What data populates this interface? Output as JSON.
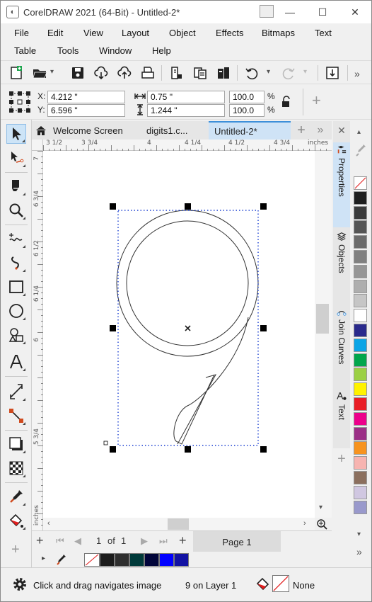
{
  "window": {
    "title": "CorelDRAW 2021 (64-Bit) - Untitled-2*",
    "minimize": "—",
    "maximize": "☐",
    "close": "✕"
  },
  "menu": {
    "row1": [
      "File",
      "Edit",
      "View",
      "Layout",
      "Object",
      "Effects",
      "Bitmaps",
      "Text"
    ],
    "row2": [
      "Table",
      "Tools",
      "Window",
      "Help"
    ]
  },
  "propbar": {
    "x_label": "X:",
    "y_label": "Y:",
    "x_value": "4.212 \"",
    "y_value": "6.596 \"",
    "width_value": "0.75 \"",
    "height_value": "1.244 \"",
    "scale_x": "100.0",
    "scale_y": "100.0",
    "percent_x": "%",
    "percent_y": "%",
    "add": "+"
  },
  "tabs": {
    "welcome": "Welcome Screen",
    "digits": "digits1.c...",
    "current": "Untitled-2*"
  },
  "ruler": {
    "h_labels": [
      "3 1/2",
      "3 3/4",
      "4",
      "4 1/4",
      "4 1/2",
      "4 3/4"
    ],
    "units": "inches",
    "v_labels": [
      "7",
      "6 3/4",
      "6 1/2",
      "6 1/4",
      "6",
      "5 3/4"
    ],
    "v_units": "inches"
  },
  "pagenav": {
    "current": "1",
    "of": "of",
    "total": "1",
    "page_tab": "Page 1",
    "add": "+"
  },
  "docker": {
    "tabs": [
      "Properties",
      "Objects",
      "Join Curves",
      "Text"
    ],
    "close": "✕",
    "add": "+"
  },
  "palette": {
    "colors": [
      "#ffffff",
      "#1e1e1e",
      "#3b3b3b",
      "#545454",
      "#6b6b6b",
      "#808080",
      "#969696",
      "#aeaeae",
      "#c6c6c6",
      "#ffffff",
      "#2a2a8c",
      "#0ba5e6",
      "#02a64c",
      "#9bd044",
      "#fff200",
      "#e91d25",
      "#ec008b",
      "#9b2f86",
      "#f7931e",
      "#f7b4b0",
      "#8b6f5e",
      "#d0c7e1",
      "#9999cc"
    ]
  },
  "docpalette": {
    "colors": [
      "#1b1b1b",
      "#2e2e2e",
      "#003a3a",
      "#00043a",
      "#0000ff",
      "#1212a3"
    ]
  },
  "status": {
    "hint": "Click and drag navigates image",
    "layer": "9 on Layer 1",
    "outline": "None"
  }
}
